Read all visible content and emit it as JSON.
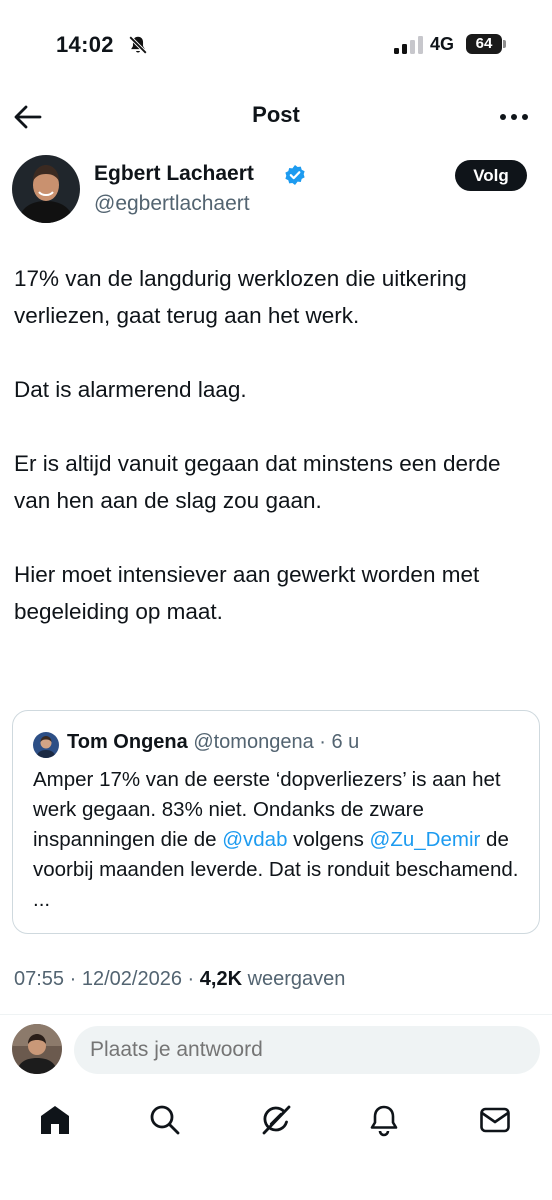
{
  "status_bar": {
    "time": "14:02",
    "network": "4G",
    "battery": "64"
  },
  "header": {
    "title": "Post"
  },
  "author": {
    "name": "Egbert Lachaert",
    "handle": "@egbertlachaert",
    "follow_label": "Volg"
  },
  "post": {
    "paragraphs": [
      "17% van de langdurig werklozen die uitkering verliezen, gaat terug aan het werk.",
      "Dat is alarmerend laag.",
      "Er is altijd vanuit gegaan dat minstens een derde van hen aan de slag zou gaan.",
      "Hier moet intensiever aan gewerkt worden met begeleiding op maat."
    ]
  },
  "quote": {
    "name": "Tom Ongena",
    "handle": "@tomongena",
    "separator": "·",
    "age": "6 u",
    "text_1": "Amper 17% van de eerste ‘dopverliezers’ is aan het werk gegaan. 83% niet. Ondanks de zware inspanningen die de ",
    "mention_1": "@vdab",
    "text_2": " volgens ",
    "mention_2": "@Zu_Demir",
    "text_3": " de voorbij maanden leverde. Dat is ronduit beschamend. ..."
  },
  "meta": {
    "time": "07:55",
    "separator": "·",
    "date": "12/02/2026",
    "views_count": "4,2K",
    "views_label": "weergaven"
  },
  "reply": {
    "placeholder": "Plaats je antwoord"
  },
  "icons": {
    "back": "arrow-left-icon",
    "more": "more-horizontal-icon",
    "verified": "verified-badge-icon",
    "bell_off": "bell-slash-icon",
    "tabs": [
      "home-icon",
      "search-icon",
      "grok-icon",
      "notifications-icon",
      "messages-icon"
    ]
  },
  "colors": {
    "text": "#0f1419",
    "secondary": "#536471",
    "accent": "#1d9bf0",
    "border": "#cfd9de",
    "input_bg": "#eff3f4"
  }
}
